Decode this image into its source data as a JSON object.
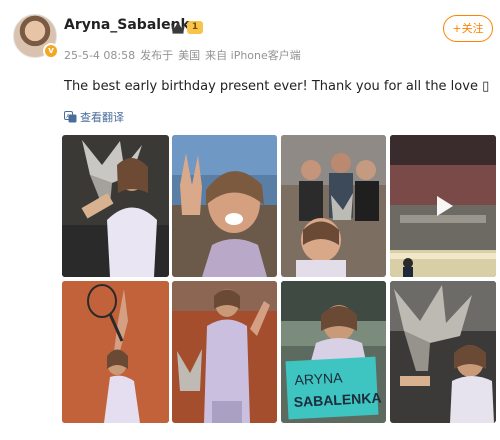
{
  "post": {
    "username": "Aryna_Sabalenka",
    "vip_level": "1",
    "timestamp": "25-5-4 08:58",
    "source_prefix": "发布于",
    "location": "美国",
    "device": "来自 iPhone客户端",
    "follow_label": "+关注",
    "text": "The best early birthday present ever! Thank you for all the love ▯",
    "translate_label": "查看翻译"
  },
  "photos": [
    {
      "label": "",
      "kind": "trophy-hold"
    },
    {
      "label": "",
      "kind": "selfie-peace"
    },
    {
      "label": "",
      "kind": "team-trophy"
    },
    {
      "label": "",
      "kind": "stadium-video"
    },
    {
      "label": "",
      "kind": "clay-serve"
    },
    {
      "label": "",
      "kind": "celebration"
    },
    {
      "label": "ARYNA SABALENKA",
      "line1": "ARYNA",
      "line2": "SABALENKA",
      "kind": "banner"
    },
    {
      "label": "",
      "kind": "trophy-close"
    }
  ],
  "colors": {
    "follow": "#ff8200",
    "translate": "#4a6c9b",
    "meta": "#939393",
    "banner": "#3ec5c2"
  }
}
